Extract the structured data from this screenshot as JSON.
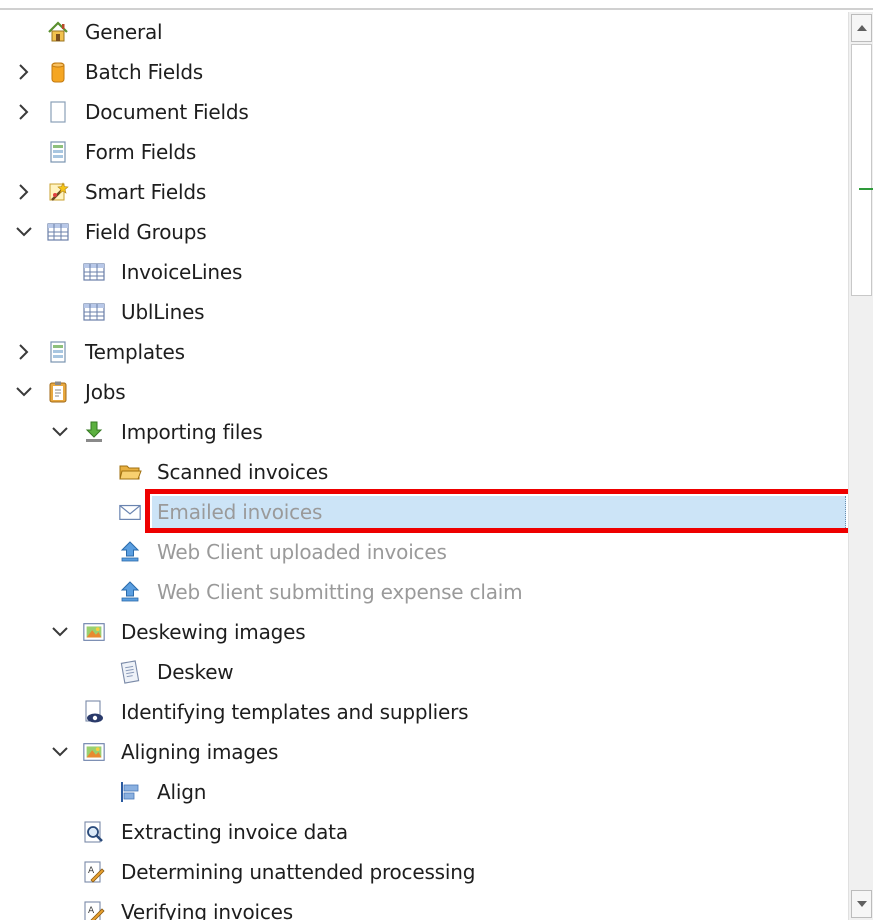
{
  "tree": {
    "items": [
      {
        "key": "general",
        "label": "General",
        "level": 0,
        "chevron": "none",
        "icon": "home-icon",
        "dim": false
      },
      {
        "key": "batch-fields",
        "label": "Batch Fields",
        "level": 0,
        "chevron": "collapsed",
        "icon": "database-icon",
        "dim": false
      },
      {
        "key": "document-fields",
        "label": "Document Fields",
        "level": 0,
        "chevron": "collapsed",
        "icon": "document-icon",
        "dim": false
      },
      {
        "key": "form-fields",
        "label": "Form Fields",
        "level": 0,
        "chevron": "none",
        "icon": "form-icon",
        "dim": false
      },
      {
        "key": "smart-fields",
        "label": "Smart Fields",
        "level": 0,
        "chevron": "collapsed",
        "icon": "magic-wand-icon",
        "dim": false
      },
      {
        "key": "field-groups",
        "label": "Field Groups",
        "level": 0,
        "chevron": "expanded",
        "icon": "table-icon",
        "dim": false
      },
      {
        "key": "invoicelines",
        "label": "InvoiceLines",
        "level": 1,
        "chevron": "none",
        "icon": "table-icon",
        "dim": false
      },
      {
        "key": "ubllines",
        "label": "UblLines",
        "level": 1,
        "chevron": "none",
        "icon": "table-icon",
        "dim": false
      },
      {
        "key": "templates",
        "label": "Templates",
        "level": 0,
        "chevron": "collapsed",
        "icon": "form-icon",
        "dim": false
      },
      {
        "key": "jobs",
        "label": "Jobs",
        "level": 0,
        "chevron": "expanded",
        "icon": "clipboard-icon",
        "dim": false
      },
      {
        "key": "importing-files",
        "label": "Importing files",
        "level": 1,
        "chevron": "expanded",
        "icon": "download-icon",
        "dim": false
      },
      {
        "key": "scanned-invoices",
        "label": "Scanned invoices",
        "level": 2,
        "chevron": "none",
        "icon": "folder-icon",
        "dim": false
      },
      {
        "key": "emailed-invoices",
        "label": "Emailed invoices",
        "level": 2,
        "chevron": "none",
        "icon": "envelope-icon",
        "dim": true,
        "selected": true
      },
      {
        "key": "web-client-uploaded",
        "label": "Web Client uploaded invoices",
        "level": 2,
        "chevron": "none",
        "icon": "upload-icon",
        "dim": true
      },
      {
        "key": "web-client-expense",
        "label": "Web Client submitting expense claim",
        "level": 2,
        "chevron": "none",
        "icon": "upload-icon",
        "dim": true
      },
      {
        "key": "deskewing-images",
        "label": "Deskewing images",
        "level": 1,
        "chevron": "expanded",
        "icon": "image-icon",
        "dim": false
      },
      {
        "key": "deskew",
        "label": "Deskew",
        "level": 2,
        "chevron": "none",
        "icon": "page-icon",
        "dim": false
      },
      {
        "key": "identifying-templates",
        "label": "Identifying templates and suppliers",
        "level": 1,
        "chevron": "none",
        "icon": "eye-document-icon",
        "dim": false
      },
      {
        "key": "aligning-images",
        "label": "Aligning images",
        "level": 1,
        "chevron": "expanded",
        "icon": "image-icon",
        "dim": false
      },
      {
        "key": "align",
        "label": "Align",
        "level": 2,
        "chevron": "none",
        "icon": "align-icon",
        "dim": false
      },
      {
        "key": "extracting-invoice-data",
        "label": "Extracting invoice data",
        "level": 1,
        "chevron": "none",
        "icon": "magnifier-document-icon",
        "dim": false
      },
      {
        "key": "determining-unattended",
        "label": "Determining unattended processing",
        "level": 1,
        "chevron": "none",
        "icon": "pen-document-icon",
        "dim": false
      },
      {
        "key": "verifying-invoices",
        "label": "Verifying invoices",
        "level": 1,
        "chevron": "none",
        "icon": "pen-document-icon",
        "dim": false
      }
    ]
  },
  "colors": {
    "selection": "#cce4f7",
    "highlight_box": "#ee0000",
    "dim_text": "#9a9a9a",
    "text": "#1e1e1e"
  }
}
